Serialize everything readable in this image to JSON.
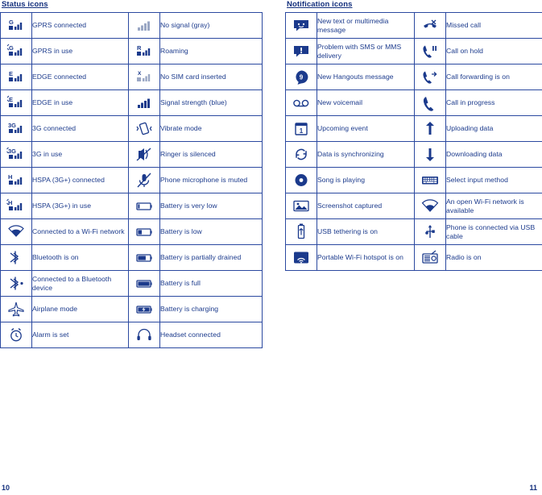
{
  "left_section": {
    "title": "Status icons",
    "rows": [
      {
        "icon1": "gprs-connected-icon",
        "label1": "GPRS connected",
        "icon2": "no-signal-icon",
        "label2": "No signal (gray)"
      },
      {
        "icon1": "gprs-in-use-icon",
        "label1": "GPRS in use",
        "icon2": "roaming-icon",
        "label2": "Roaming"
      },
      {
        "icon1": "edge-connected-icon",
        "label1": "EDGE connected",
        "icon2": "no-sim-card-icon",
        "label2": "No SIM card inserted"
      },
      {
        "icon1": "edge-in-use-icon",
        "label1": "EDGE in use",
        "icon2": "signal-strength-icon",
        "label2": "Signal strength (blue)"
      },
      {
        "icon1": "3g-connected-icon",
        "label1": "3G connected",
        "icon2": "vibrate-mode-icon",
        "label2": "Vibrate mode"
      },
      {
        "icon1": "3g-in-use-icon",
        "label1": "3G in use",
        "icon2": "ringer-silenced-icon",
        "label2": "Ringer is silenced"
      },
      {
        "icon1": "hspa-connected-icon",
        "label1": "HSPA (3G+) connected",
        "icon2": "microphone-muted-icon",
        "label2": "Phone microphone is muted"
      },
      {
        "icon1": "hspa-in-use-icon",
        "label1": "HSPA (3G+) in use",
        "icon2": "battery-very-low-icon",
        "label2": "Battery is very low"
      },
      {
        "icon1": "wifi-connected-icon",
        "label1": "Connected to a Wi-Fi network",
        "icon2": "battery-low-icon",
        "label2": "Battery is low"
      },
      {
        "icon1": "bluetooth-on-icon",
        "label1": "Bluetooth is on",
        "icon2": "battery-partially-drained-icon",
        "label2": "Battery is partially drained"
      },
      {
        "icon1": "bluetooth-connected-icon",
        "label1": "Connected to a Bluetooth device",
        "icon2": "battery-full-icon",
        "label2": "Battery is full"
      },
      {
        "icon1": "airplane-mode-icon",
        "label1": "Airplane mode",
        "icon2": "battery-charging-icon",
        "label2": "Battery is charging"
      },
      {
        "icon1": "alarm-set-icon",
        "label1": "Alarm is set",
        "icon2": "headset-connected-icon",
        "label2": "Headset connected"
      }
    ]
  },
  "right_section": {
    "title": "Notification icons",
    "rows": [
      {
        "icon1": "new-message-icon",
        "label1": "New text or multimedia message",
        "icon2": "missed-call-icon",
        "label2": "Missed call"
      },
      {
        "icon1": "message-problem-icon",
        "label1": "Problem with SMS or MMS delivery",
        "icon2": "call-on-hold-icon",
        "label2": "Call on hold"
      },
      {
        "icon1": "hangouts-message-icon",
        "label1": "New Hangouts message",
        "icon2": "call-forwarding-icon",
        "label2": "Call forwarding is on"
      },
      {
        "icon1": "voicemail-icon",
        "label1": "New voicemail",
        "icon2": "call-in-progress-icon",
        "label2": "Call in progress"
      },
      {
        "icon1": "upcoming-event-icon",
        "label1": "Upcoming event",
        "icon2": "upload-icon",
        "label2": "Uploading data"
      },
      {
        "icon1": "sync-icon",
        "label1": "Data is synchronizing",
        "icon2": "download-icon",
        "label2": "Downloading data"
      },
      {
        "icon1": "song-playing-icon",
        "label1": "Song is playing",
        "icon2": "keyboard-icon",
        "label2": "Select input method"
      },
      {
        "icon1": "screenshot-icon",
        "label1": "Screenshot captured",
        "icon2": "open-wifi-icon",
        "label2": "An open Wi-Fi network is available"
      },
      {
        "icon1": "usb-tethering-icon",
        "label1": "USB tethering is on",
        "icon2": "usb-connected-icon",
        "label2": "Phone is connected via USB cable"
      },
      {
        "icon1": "portable-hotspot-icon",
        "label1": "Portable Wi-Fi hotspot is on",
        "icon2": "radio-icon",
        "label2": "Radio is on"
      }
    ]
  },
  "footer": {
    "left_page": "10",
    "right_page": "11"
  },
  "colors": {
    "ink": "#1b3a8c",
    "rule": "#2b49a0"
  }
}
